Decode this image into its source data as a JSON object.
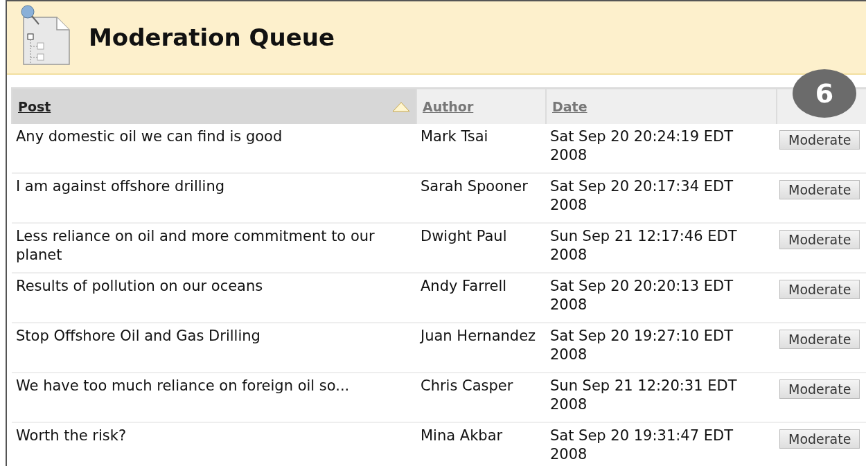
{
  "page": {
    "title": "Moderation Queue"
  },
  "callout": "6",
  "table": {
    "columns": [
      {
        "label": "Post",
        "sorted": true
      },
      {
        "label": "Author",
        "sorted": false
      },
      {
        "label": "Date",
        "sorted": false
      },
      {
        "sorted": false
      }
    ],
    "rows": [
      {
        "post": "Any domestic oil we can find is good",
        "author": "Mark Tsai",
        "date": "Sat Sep 20 20:24:19 EDT 2008",
        "action": "Moderate"
      },
      {
        "post": "I am against offshore drilling",
        "author": "Sarah Spooner",
        "date": "Sat Sep 20 20:17:34 EDT 2008",
        "action": "Moderate"
      },
      {
        "post": "Less reliance on oil and more commitment to our planet",
        "author": "Dwight Paul",
        "date": "Sun Sep 21 12:17:46 EDT 2008",
        "action": "Moderate"
      },
      {
        "post": "Results of pollution on our oceans",
        "author": "Andy Farrell",
        "date": "Sat Sep 20 20:20:13 EDT 2008",
        "action": "Moderate"
      },
      {
        "post": "Stop Offshore Oil and Gas Drilling",
        "author": "Juan Hernandez",
        "date": "Sat Sep 20 19:27:10 EDT 2008",
        "action": "Moderate"
      },
      {
        "post": "We have too much reliance on foreign oil so...",
        "author": "Chris Casper",
        "date": "Sun Sep 21 12:20:31 EDT 2008",
        "action": "Moderate"
      },
      {
        "post": "Worth the risk?",
        "author": "Mina Akbar",
        "date": "Sat Sep 20 19:31:47 EDT 2008",
        "action": "Moderate"
      }
    ]
  }
}
